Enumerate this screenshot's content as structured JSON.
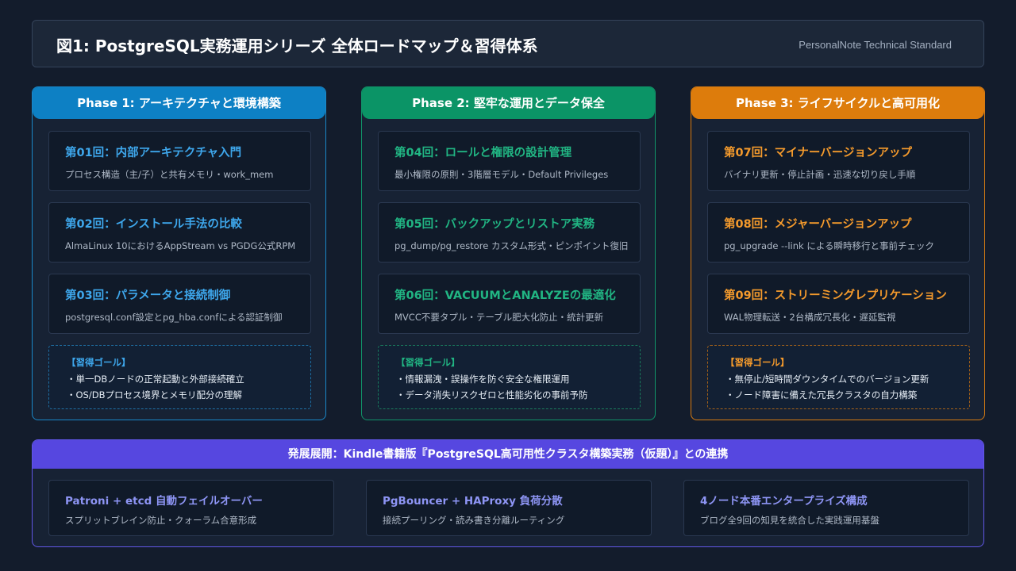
{
  "header": {
    "title": "図1: PostgreSQL実務運用シリーズ 全体ロードマップ＆習得体系",
    "subtitle": "PersonalNote Technical Standard"
  },
  "phases": [
    {
      "title": "Phase 1: アーキテクチャと環境構築",
      "cards": [
        {
          "title": "第01回：内部アーキテクチャ入門",
          "desc": "プロセス構造（主/子）と共有メモリ・work_mem"
        },
        {
          "title": "第02回：インストール手法の比較",
          "desc": "AlmaLinux 10におけるAppStream vs PGDG公式RPM"
        },
        {
          "title": "第03回：パラメータと接続制御",
          "desc": "postgresql.conf設定とpg_hba.confによる認証制御"
        }
      ],
      "goal": {
        "heading": "【習得ゴール】",
        "items": [
          "・単一DBノードの正常起動と外部接続確立",
          "・OS/DBプロセス境界とメモリ配分の理解"
        ]
      }
    },
    {
      "title": "Phase 2: 堅牢な運用とデータ保全",
      "cards": [
        {
          "title": "第04回：ロールと権限の設計管理",
          "desc": "最小権限の原則・3階層モデル・Default Privileges"
        },
        {
          "title": "第05回：バックアップとリストア実務",
          "desc": "pg_dump/pg_restore カスタム形式・ピンポイント復旧"
        },
        {
          "title": "第06回：VACUUMとANALYZEの最適化",
          "desc": "MVCC不要タプル・テーブル肥大化防止・統計更新"
        }
      ],
      "goal": {
        "heading": "【習得ゴール】",
        "items": [
          "・情報漏洩・誤操作を防ぐ安全な権限運用",
          "・データ消失リスクゼロと性能劣化の事前予防"
        ]
      }
    },
    {
      "title": "Phase 3: ライフサイクルと高可用化",
      "cards": [
        {
          "title": "第07回：マイナーバージョンアップ",
          "desc": "バイナリ更新・停止計画・迅速な切り戻し手順"
        },
        {
          "title": "第08回：メジャーバージョンアップ",
          "desc": "pg_upgrade --link による瞬時移行と事前チェック"
        },
        {
          "title": "第09回：ストリーミングレプリケーション",
          "desc": "WAL物理転送・2台構成冗長化・遅延監視"
        }
      ],
      "goal": {
        "heading": "【習得ゴール】",
        "items": [
          "・無停止/短時間ダウンタイムでのバージョン更新",
          "・ノード障害に備えた冗長クラスタの自力構築"
        ]
      }
    }
  ],
  "development": {
    "title": "発展展開：Kindle書籍版『PostgreSQL高可用性クラスタ構築実務（仮題）』との連携",
    "cards": [
      {
        "title": "Patroni + etcd 自動フェイルオーバー",
        "desc": "スプリットブレイン防止・クォーラム合意形成"
      },
      {
        "title": "PgBouncer + HAProxy 負荷分散",
        "desc": "接続プーリング・読み書き分離ルーティング"
      },
      {
        "title": "4ノード本番エンタープライズ構成",
        "desc": "ブログ全9回の知見を統合した実践運用基盤"
      }
    ]
  },
  "colors": {
    "phase1": "#0d80c4",
    "phase2": "#0b9466",
    "phase3": "#dd7c0c",
    "development": "#5647e0"
  }
}
